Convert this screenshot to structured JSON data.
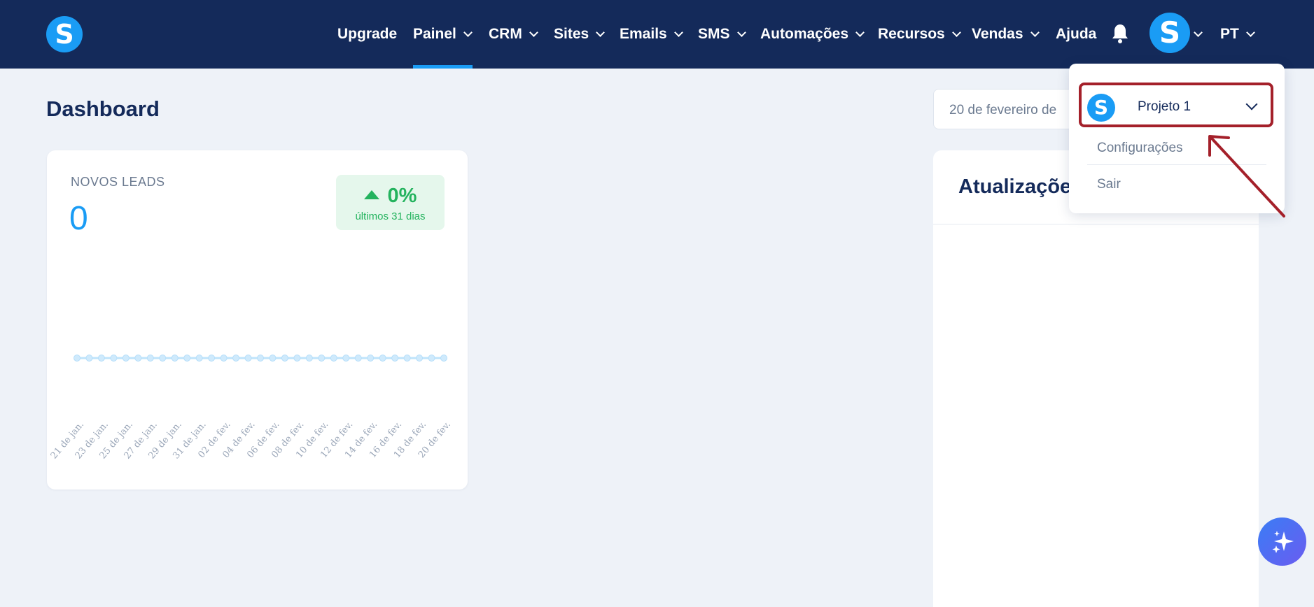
{
  "header": {
    "logo_letter": "S",
    "nav": [
      {
        "label": "Upgrade",
        "dropdown": false
      },
      {
        "label": "Painel",
        "dropdown": true,
        "active": true
      },
      {
        "label": "CRM",
        "dropdown": true
      },
      {
        "label": "Sites",
        "dropdown": true
      },
      {
        "label": "Emails",
        "dropdown": true
      },
      {
        "label": "SMS",
        "dropdown": true
      },
      {
        "label": "Automações",
        "dropdown": true
      },
      {
        "label": "Recursos",
        "dropdown": true
      },
      {
        "label": "Vendas",
        "dropdown": true
      },
      {
        "label": "Ajuda",
        "dropdown": false
      }
    ],
    "bell_icon": "bell-icon",
    "avatar_letter": "S",
    "language": "PT"
  },
  "page": {
    "title": "Dashboard",
    "date_range": "20 de fevereiro de"
  },
  "leads_card": {
    "label": "NOVOS LEADS",
    "value": "0",
    "change_pct": "0%",
    "change_period": "últimos 31 dias"
  },
  "updates_card": {
    "title": "Atualizações"
  },
  "account_menu": {
    "project_letter": "S",
    "project_name": "Projeto 1",
    "items": [
      "Configurações",
      "Sair"
    ]
  },
  "colors": {
    "nav_bg": "#142a5a",
    "accent": "#1a9cf5",
    "positive": "#24b35e",
    "highlight": "#a4202a"
  },
  "chart_data": {
    "type": "line",
    "title": "",
    "xlabel": "",
    "ylabel": "",
    "x": [
      "21 de jan.",
      "22 de jan.",
      "23 de jan.",
      "24 de jan.",
      "25 de jan.",
      "26 de jan.",
      "27 de jan.",
      "28 de jan.",
      "29 de jan.",
      "30 de jan.",
      "31 de jan.",
      "01 de fev.",
      "02 de fev.",
      "03 de fev.",
      "04 de fev.",
      "05 de fev.",
      "06 de fev.",
      "07 de fev.",
      "08 de fev.",
      "09 de fev.",
      "10 de fev.",
      "11 de fev.",
      "12 de fev.",
      "13 de fev.",
      "14 de fev.",
      "15 de fev.",
      "16 de fev.",
      "17 de fev.",
      "18 de fev.",
      "19 de fev.",
      "20 de fev."
    ],
    "tick_labels": [
      "21 de jan.",
      "23 de jan.",
      "25 de jan.",
      "27 de jan.",
      "29 de jan.",
      "31 de jan.",
      "02 de fev.",
      "04 de fev.",
      "06 de fev.",
      "08 de fev.",
      "10 de fev.",
      "12 de fev.",
      "14 de fev.",
      "16 de fev.",
      "18 de fev.",
      "20 de fev."
    ],
    "series": [
      {
        "values": [
          0,
          0,
          0,
          0,
          0,
          0,
          0,
          0,
          0,
          0,
          0,
          0,
          0,
          0,
          0,
          0,
          0,
          0,
          0,
          0,
          0,
          0,
          0,
          0,
          0,
          0,
          0,
          0,
          0,
          0,
          0
        ]
      }
    ],
    "grid": false
  }
}
